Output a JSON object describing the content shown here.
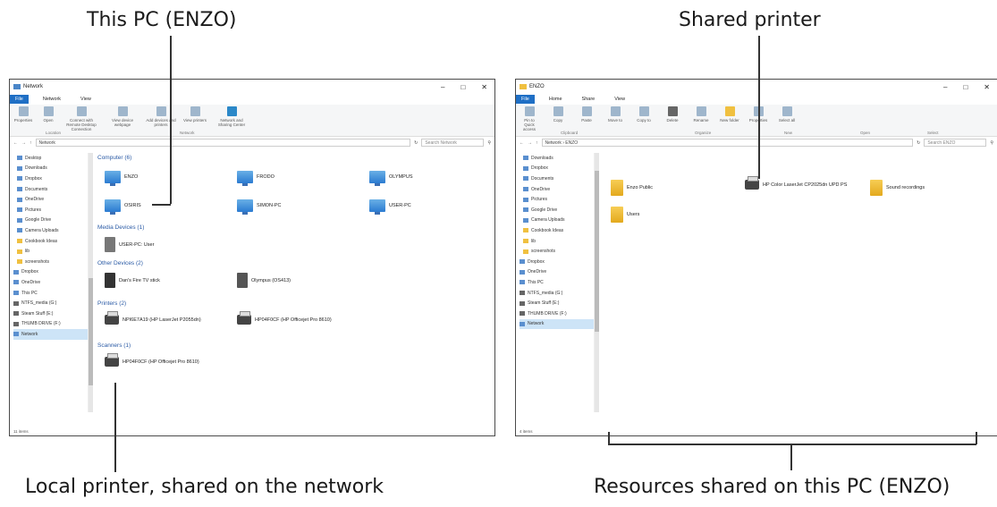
{
  "callouts": {
    "this_pc": "This PC (ENZO)",
    "shared_printer": "Shared printer",
    "local_printer": "Local printer, shared on the network",
    "resources": "Resources shared on this PC (ENZO)"
  },
  "left_window": {
    "title": "Network",
    "controls": [
      "–",
      "□",
      "✕"
    ],
    "tabs": [
      "File",
      "Network",
      "View"
    ],
    "ribbon": [
      {
        "label": "Properties"
      },
      {
        "label": "Open"
      },
      {
        "label": "Connect with Remote Desktop Connection"
      },
      {
        "label": "View device webpage"
      },
      {
        "label": "Add devices and printers"
      },
      {
        "label": "View printers"
      },
      {
        "label": "Network and Sharing Center"
      }
    ],
    "ribbon_groups": [
      "Location",
      "Network"
    ],
    "address": "Network",
    "search_placeholder": "Search Network",
    "sidebar": [
      "Desktop",
      "Downloads",
      "Dropbox",
      "Documents",
      "OneDrive",
      "Pictures",
      "Google Drive",
      "Camera Uploads",
      "Cookbook Ideas",
      "lib",
      "screenshots",
      "Dropbox",
      "OneDrive",
      "This PC",
      "NTFS_media (G:)",
      "Steam Stuff (E:)",
      "THUMB DRIVE (F:)",
      "Network"
    ],
    "groups": {
      "computer": "Computer (6)",
      "media": "Media Devices (1)",
      "other": "Other Devices (2)",
      "printers": "Printers (2)",
      "scanners": "Scanners (1)"
    },
    "computers": [
      "ENZO",
      "FRODO",
      "OLYMPUS",
      "OSIRIS",
      "SIMON-PC",
      "USER-PC"
    ],
    "media_devices": [
      "USER-PC: User"
    ],
    "other_devices": [
      "Dan's Fire TV stick",
      "Olympus (OS413)"
    ],
    "printers": [
      "NPI6E7A19 (HP LaserJet P2055dn)",
      "HP04F0CF (HP Officejet Pro 8610)"
    ],
    "scanners": [
      "HP04F0CF (HP Officejet Pro 8610)"
    ],
    "status": "11 items"
  },
  "right_window": {
    "title": "ENZO",
    "controls": [
      "–",
      "□",
      "✕"
    ],
    "tabs": [
      "File",
      "Home",
      "Share",
      "View"
    ],
    "ribbon": [
      {
        "label": "Pin to Quick access"
      },
      {
        "label": "Copy"
      },
      {
        "label": "Paste"
      },
      {
        "label": "Move to"
      },
      {
        "label": "Copy to"
      },
      {
        "label": "Delete"
      },
      {
        "label": "Rename"
      },
      {
        "label": "New folder"
      },
      {
        "label": "Properties"
      },
      {
        "label": "Select all"
      }
    ],
    "ribbon_groups": [
      "Clipboard",
      "Organize",
      "New",
      "Open",
      "Select"
    ],
    "address": "Network › ENZO",
    "search_placeholder": "Search ENZO",
    "sidebar": [
      "Downloads",
      "Dropbox",
      "Documents",
      "OneDrive",
      "Pictures",
      "Google Drive",
      "Camera Uploads",
      "Cookbook Ideas",
      "lib",
      "screenshots",
      "Dropbox",
      "OneDrive",
      "This PC",
      "NTFS_media (G:)",
      "Steam Stuff (E:)",
      "THUMB DRIVE (F:)",
      "Network"
    ],
    "items": [
      "Enzo Public",
      "HP Color LaserJet CP2025dn UPD PS",
      "Sound recordings",
      "Users"
    ],
    "status": "4 items"
  }
}
